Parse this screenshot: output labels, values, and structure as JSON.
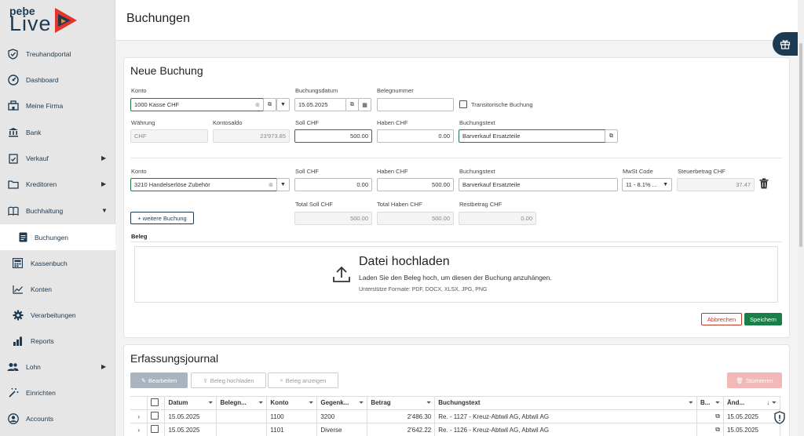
{
  "logo": {
    "brand_top": "pebe",
    "brand_main": "Live"
  },
  "sidebar": {
    "items": [
      {
        "label": "Treuhandportal",
        "icon": "shield-check-icon"
      },
      {
        "label": "Dashboard",
        "icon": "gauge-icon"
      },
      {
        "label": "Meine Firma",
        "icon": "building-icon"
      },
      {
        "label": "Bank",
        "icon": "bank-icon"
      },
      {
        "label": "Verkauf",
        "icon": "clipboard-check-icon",
        "arrow": "▶"
      },
      {
        "label": "Kreditoren",
        "icon": "folder-icon",
        "arrow": "▶"
      },
      {
        "label": "Buchhaltung",
        "icon": "book-icon",
        "arrow": "▼"
      },
      {
        "label": "Buchungen",
        "icon": "document-icon"
      },
      {
        "label": "Kassenbuch",
        "icon": "calculator-icon"
      },
      {
        "label": "Konten",
        "icon": "chart-line-icon"
      },
      {
        "label": "Verarbeitungen",
        "icon": "gear-icon"
      },
      {
        "label": "Reports",
        "icon": "bar-chart-icon"
      },
      {
        "label": "Lohn",
        "icon": "users-icon",
        "arrow": "▶"
      },
      {
        "label": "Einrichten",
        "icon": "magic-wand-icon"
      },
      {
        "label": "Accounts",
        "icon": "account-icon"
      }
    ]
  },
  "header": {
    "title": "Buchungen"
  },
  "neue_buchung": {
    "title": "Neue Buchung",
    "labels": {
      "konto": "Konto",
      "buchungsdatum": "Buchungsdatum",
      "belegnummer": "Belegnummer",
      "transitorisch": "Transitorische Buchung",
      "waehrung": "Währung",
      "kontosaldo": "Kontosaldo",
      "soll": "Soll CHF",
      "haben": "Haben CHF",
      "buchungstext": "Buchungstext",
      "mwst": "MwSt Code",
      "steuerbetrag": "Steuerbetrag CHF",
      "total_soll": "Total Soll CHF",
      "total_haben": "Total Haben CHF",
      "restbetrag": "Restbetrag CHF",
      "beleg": "Beleg"
    },
    "row1": {
      "konto": "1000 Kasse CHF",
      "datum": "15.05.2025",
      "belegnummer": "",
      "waehrung": "CHF",
      "kontosaldo": "23'973.85",
      "soll": "500.00",
      "haben": "0.00",
      "buchungstext": "Barverkauf Ersatzteile"
    },
    "row2": {
      "konto": "3210 Handelserlöse Zubehör",
      "soll": "0.00",
      "haben": "500.00",
      "buchungstext": "Barverkauf Ersatzteile",
      "mwst": "11 - 8.1% ...",
      "steuerbetrag": "37.47"
    },
    "totals": {
      "total_soll": "500.00",
      "total_haben": "500.00",
      "restbetrag": "0.00"
    },
    "add_button": "+ weitere Buchung",
    "upload": {
      "title": "Datei hochladen",
      "subtitle": "Laden Sie den Beleg hoch, um diesen der Buchung anzuhängen.",
      "formats": "Unterstütze Formate: PDF, DOCX, XLSX, JPG, PNG"
    },
    "cancel": "Abbrechen",
    "save": "Speichern"
  },
  "journal": {
    "title": "Erfassungsjournal",
    "toolbar": {
      "edit": "Bearbeiten",
      "upload": "Beleg hochladen",
      "view": "Beleg anzeigen",
      "storno": "Stornieren"
    },
    "columns": [
      "Datum",
      "Belegn...",
      "Konto",
      "Gegenk...",
      "Betrag",
      "Buchungstext",
      "B...",
      "Änd..."
    ],
    "rows": [
      {
        "datum": "15.05.2025",
        "beleg": "",
        "konto": "1100",
        "gegenkonto": "3200",
        "betrag": "2'486.30",
        "text": "Re. - 1127 - Kreuz-Abtwil AG, Abtwil AG",
        "aend": "15.05.2025"
      },
      {
        "datum": "15.05.2025",
        "beleg": "",
        "konto": "1101",
        "gegenkonto": "Diverse",
        "betrag": "2'642.22",
        "text": "Re. - 1126 - Kreuz-Abtwil AG, Abtwil AG",
        "aend": "15.05.2025"
      }
    ]
  },
  "colors": {
    "accent_navy": "#1c3a52",
    "save_green": "#1a7f47",
    "cancel_red": "#c0392b",
    "storno_red": "#f2b8b8"
  }
}
